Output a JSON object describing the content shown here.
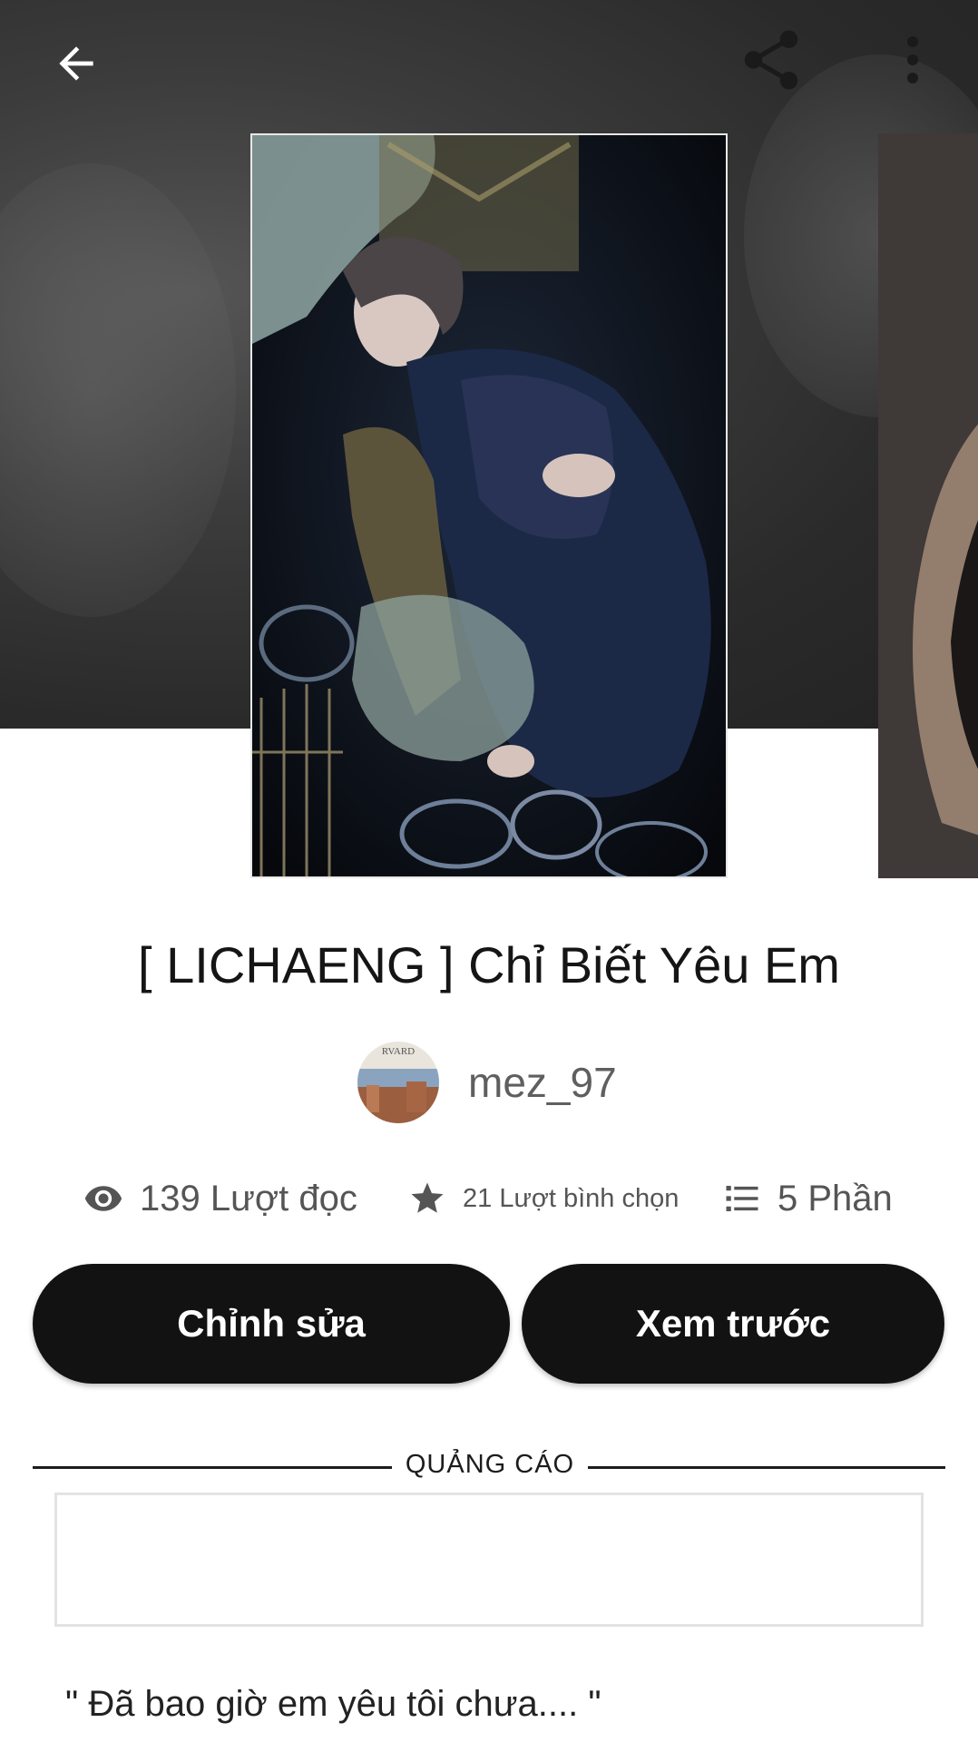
{
  "story": {
    "title": "[ LICHAENG ] Chỉ Biết Yêu Em",
    "author": "mez_97",
    "avatar_text": "RVARD",
    "blurb": "\" Đã bao giờ em yêu tôi chưa.... \""
  },
  "stats": {
    "reads": "139 Lượt đọc",
    "votes": "21 Lượt bình chọn",
    "parts": "5 Phần"
  },
  "buttons": {
    "edit": "Chỉnh sửa",
    "preview": "Xem trước"
  },
  "ad": {
    "label": "QUẢNG CÁO"
  },
  "icons": {
    "back": "arrow-left-icon",
    "share": "share-icon",
    "more": "more-vertical-icon",
    "reads": "eye-icon",
    "votes": "star-icon",
    "parts": "list-icon"
  },
  "colors": {
    "header_bg": "#2f2f2f",
    "button_bg": "#121212",
    "button_text": "#ffffff",
    "author_text": "#5f5f5f"
  }
}
